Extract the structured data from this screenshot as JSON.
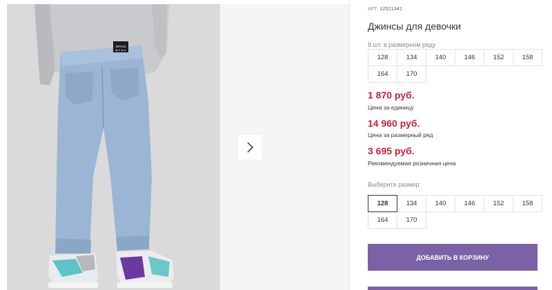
{
  "product": {
    "art_label": "АРТ.",
    "art_number": "12521341",
    "title": "Джинсы для девочки",
    "row_caption": "8 шт. в размерном ряду",
    "row_sizes": [
      "128",
      "134",
      "140",
      "146",
      "152",
      "158",
      "164",
      "170"
    ],
    "prices": [
      {
        "value": "1 870 руб.",
        "note": "Цена за единицу"
      },
      {
        "value": "14 960 руб.",
        "note": "Цена за размерный ряд"
      },
      {
        "value": "3 695 руб.",
        "note": "Рекомендуемая розничная цена"
      }
    ],
    "select_caption": "Выберите размер:",
    "select_sizes": [
      "128",
      "134",
      "140",
      "146",
      "152",
      "158",
      "164",
      "170"
    ],
    "selected_size": "128",
    "add_to_cart": "Добавить в корзину"
  },
  "gallery": {
    "badge_text": "SPACE"
  },
  "colors": {
    "accent": "#7b62a6",
    "price": "#cc1f3a"
  }
}
